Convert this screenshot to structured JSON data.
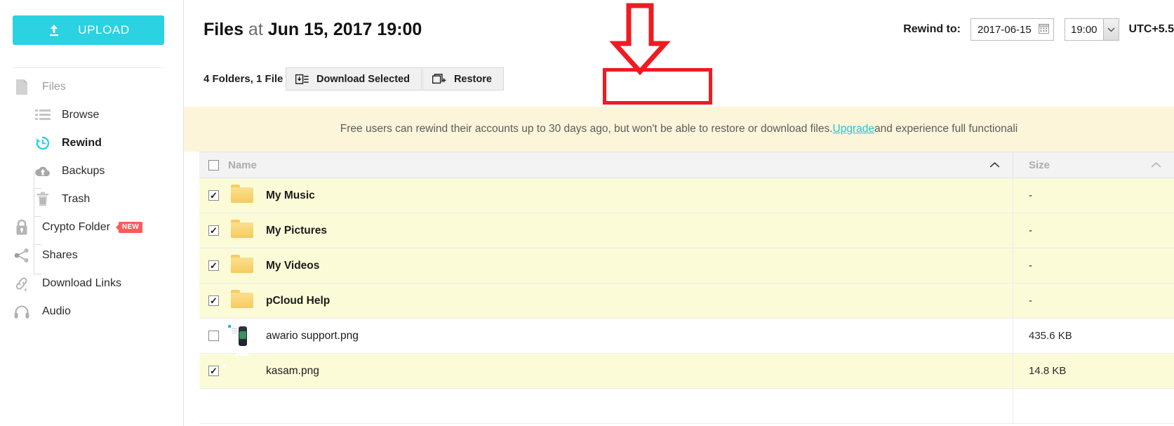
{
  "sidebar": {
    "upload_label": "UPLOAD",
    "upload_icon": "upload-icon",
    "items": [
      {
        "label": "Files",
        "icon": "file-icon",
        "type": "group",
        "muted": true
      },
      {
        "label": "Browse",
        "icon": "list-icon",
        "type": "sub"
      },
      {
        "label": "Rewind",
        "icon": "rewind-clock-icon",
        "type": "sub",
        "active": true
      },
      {
        "label": "Backups",
        "icon": "cloud-upload-icon",
        "type": "sub"
      },
      {
        "label": "Trash",
        "icon": "trash-icon",
        "type": "sub"
      },
      {
        "label": "Crypto Folder",
        "icon": "lock-icon",
        "type": "top",
        "badge": "NEW"
      },
      {
        "label": "Shares",
        "icon": "share-icon",
        "type": "top"
      },
      {
        "label": "Download Links",
        "icon": "link-icon",
        "type": "top"
      },
      {
        "label": "Audio",
        "icon": "headphones-icon",
        "type": "top"
      }
    ]
  },
  "header": {
    "title_prefix": "Files",
    "title_connector": " at ",
    "title_time": "Jun 15, 2017 19:00",
    "rewind_label": "Rewind to:",
    "date_value": "2017-06-15",
    "date_icon": "calendar-icon",
    "time_value": "19:00",
    "time_dropdown_icon": "chevron-down-icon",
    "timezone": "UTC+5.5"
  },
  "toolbar": {
    "count_label": "4 Folders, 1 File",
    "download_label": "Download Selected",
    "download_icon": "download-box-icon",
    "restore_label": "Restore",
    "restore_icon": "restore-window-icon"
  },
  "banner": {
    "text_before": "Free users can rewind their accounts up to 30 days ago, but won't be able to restore or download files. ",
    "link_text": "Upgrade",
    "text_after": " and experience full functionali"
  },
  "table": {
    "header": {
      "name": "Name",
      "size": "Size",
      "name_sort_icon": "chevron-up-icon",
      "size_sort_icon": "chevron-up-icon",
      "select_all_checked": false
    },
    "rows": [
      {
        "name": "My Music",
        "size": "-",
        "checked": true,
        "kind": "folder",
        "thumb": "folder-icon"
      },
      {
        "name": "My Pictures",
        "size": "-",
        "checked": true,
        "kind": "folder",
        "thumb": "folder-icon"
      },
      {
        "name": "My Videos",
        "size": "-",
        "checked": true,
        "kind": "folder",
        "thumb": "folder-icon"
      },
      {
        "name": "pCloud Help",
        "size": "-",
        "checked": true,
        "kind": "folder",
        "thumb": "folder-icon"
      },
      {
        "name": "awario support.png",
        "size": "435.6 KB",
        "checked": false,
        "kind": "file",
        "thumb": "photo-thumbnail"
      },
      {
        "name": "kasam.png",
        "size": "14.8 KB",
        "checked": true,
        "kind": "file",
        "thumb": "image-placeholder-icon"
      }
    ]
  },
  "annotation": {
    "arrow_color": "#ef1b21",
    "rect_color": "#ef1b21",
    "target": "restore-button"
  },
  "colors": {
    "accent": "#2ad2e2",
    "selected_row": "#fbfbd8",
    "banner_bg": "#fdf5d9",
    "link": "#29c2d3",
    "badge": "#ff5a5a"
  }
}
